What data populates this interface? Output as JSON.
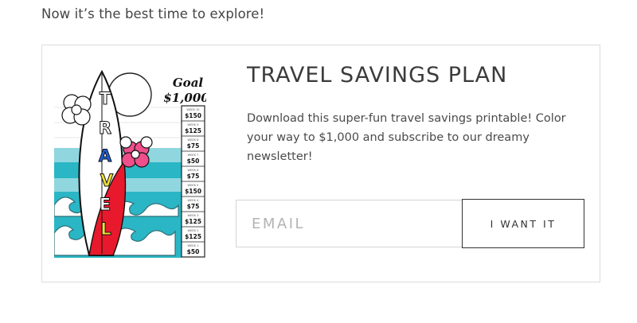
{
  "intro": {
    "text": "Now it’s the best time to explore!"
  },
  "card": {
    "title": "TRAVEL SAVINGS PLAN",
    "description": "Download this super-fun travel savings printable! Color your way to $1,000 and subscribe to our dreamy newsletter!",
    "email_placeholder": "EMAIL",
    "email_value": "",
    "button_label": "I WANT IT"
  },
  "poster": {
    "goal_label": "Goal",
    "goal_amount": "$1,000",
    "word_letters": [
      "T",
      "R",
      "A",
      "V",
      "E",
      "L"
    ],
    "letter_colors": [
      "#ffffff",
      "#ffffff",
      "#1f5fd6",
      "#f3e233",
      "#ffffff",
      "#f3e233"
    ],
    "weeks": [
      {
        "week": "WEEK 10",
        "amount": "$150"
      },
      {
        "week": "WEEK 9",
        "amount": "$125"
      },
      {
        "week": "WEEK 8",
        "amount": "$75"
      },
      {
        "week": "WEEK 7",
        "amount": "$50"
      },
      {
        "week": "WEEK 6",
        "amount": "$75"
      },
      {
        "week": "WEEK 5",
        "amount": "$150"
      },
      {
        "week": "WEEK 4",
        "amount": "$75"
      },
      {
        "week": "WEEK 3",
        "amount": "$125"
      },
      {
        "week": "WEEK 2",
        "amount": "$125"
      },
      {
        "week": "WEEK 1",
        "amount": "$50"
      }
    ],
    "colors": {
      "sea": "#2bb6c6",
      "sea_light": "#8fd6df",
      "board_red": "#e8192c",
      "flower_pink": "#ef4f8a"
    }
  }
}
